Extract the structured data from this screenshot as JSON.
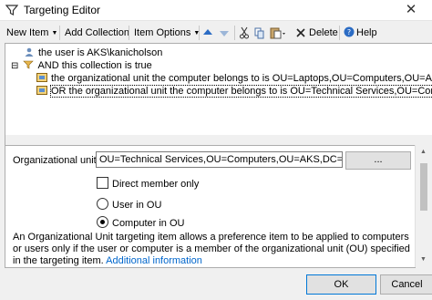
{
  "window": {
    "title": "Targeting Editor",
    "close_glyph": "✕"
  },
  "toolbar": {
    "new_item": "New Item",
    "add_collection": "Add Collection",
    "item_options": "Item Options",
    "delete": "Delete",
    "help": "Help"
  },
  "tree": {
    "rows": [
      {
        "text": "the user is AKS\\kanicholson",
        "icon": "user-icon"
      },
      {
        "text": "AND this collection is true",
        "icon": "collection-icon"
      },
      {
        "text": "the organizational unit the computer belongs to is OU=Laptops,OU=Computers,OU=AKS,DC=aks,DC=c",
        "icon": "ou-icon"
      },
      {
        "text": "OR the organizational unit the computer belongs to is OU=Technical Services,OU=Computers,OU=AKS,DC=ak",
        "icon": "ou-icon"
      }
    ],
    "expand_glyph": "⊟"
  },
  "panel": {
    "ou_label": "Organizational unit",
    "ou_value": "OU=Technical Services,OU=Computers,OU=AKS,DC=aks,DC=c",
    "browse_label": "...",
    "direct_member_label": "Direct member only",
    "direct_member_checked": false,
    "user_in_ou_label": "User in OU",
    "computer_in_ou_label": "Computer in OU",
    "selected_scope": "Computer in OU",
    "description": "An Organizational Unit targeting item allows a preference item to be applied to computers or users only if the user or computer is a member of the organizational unit (OU) specified in the targeting item.",
    "more_info_link": "Additional information"
  },
  "buttons": {
    "ok": "OK",
    "cancel": "Cancel"
  },
  "colors": {
    "link": "#0066cc",
    "ok_border": "#0078d7",
    "selection": "#0078d7"
  }
}
